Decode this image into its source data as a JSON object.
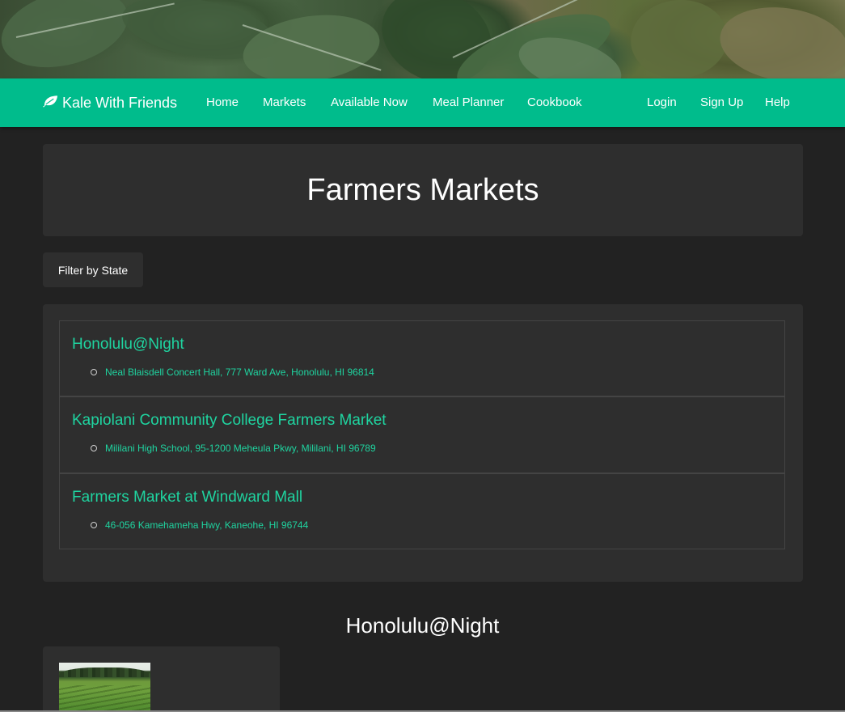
{
  "navbar": {
    "brand": "Kale With Friends",
    "brand_icon": "leaf-icon",
    "links": [
      "Home",
      "Markets",
      "Available Now",
      "Meal Planner",
      "Cookbook"
    ],
    "right_links": [
      "Login",
      "Sign Up",
      "Help"
    ]
  },
  "header": {
    "title": "Farmers Markets"
  },
  "filter": {
    "label": "Filter by State"
  },
  "markets": [
    {
      "name": "Honolulu@Night",
      "address": "Neal Blaisdell Concert Hall, 777 Ward Ave, Honolulu, HI 96814"
    },
    {
      "name": "Kapiolani Community College Farmers Market",
      "address": "Mililani High School, 95-1200 Meheula Pkwy, Mililani, HI 96789"
    },
    {
      "name": "Farmers Market at Windward Mall",
      "address": "46-056 Kamehameha Hwy, Kaneohe, HI 96744"
    }
  ],
  "selected_market": {
    "title": "Honolulu@Night"
  },
  "colors": {
    "accent": "#00bc8c",
    "link": "#1fd4a0",
    "background": "#222222",
    "card": "#2e2e2e"
  }
}
